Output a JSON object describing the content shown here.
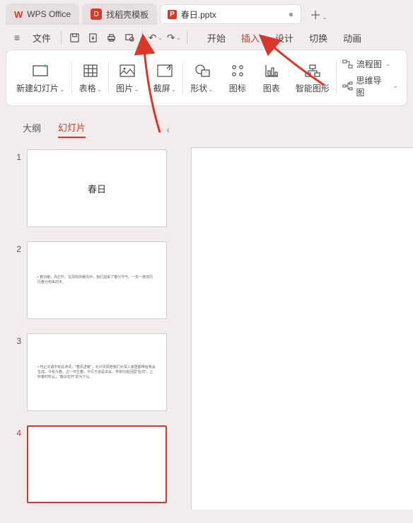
{
  "tabs": {
    "app_name": "WPS Office",
    "template_tab": "找稻壳模板",
    "doc_name": "春日.pptx"
  },
  "menu": {
    "file": "文件",
    "tabs": {
      "start": "开始",
      "insert": "插入",
      "design": "设计",
      "transition": "切换",
      "animation": "动画"
    }
  },
  "ribbon": {
    "new_slide": "新建幻灯片",
    "table": "表格",
    "picture": "图片",
    "screenshot": "截屏",
    "shape": "形状",
    "icon": "图标",
    "chart": "图表",
    "smartart": "智能图形",
    "flowchart": "流程图",
    "mindmap": "思维导图"
  },
  "panel": {
    "outline": "大纲",
    "slides": "幻灯片"
  },
  "slides": [
    {
      "num": "1",
      "title": "春日"
    },
    {
      "num": "2",
      "text": "• 春日暖，风已升。在风吹的暖风中，我们迎来了春分节气。一年一度的历历春分到来的天。"
    },
    {
      "num": "3",
      "text": "• 何止汉语中有此诗词，\"春风送暖\"，北计风情陪我们对深入家居都带给我会生成。今有九春。古一作生春。今行万道是关会。学校均有回国\"名词\"。上所春时所认，\"春白花开\"的为下认。"
    },
    {
      "num": "4",
      "text": ""
    }
  ]
}
